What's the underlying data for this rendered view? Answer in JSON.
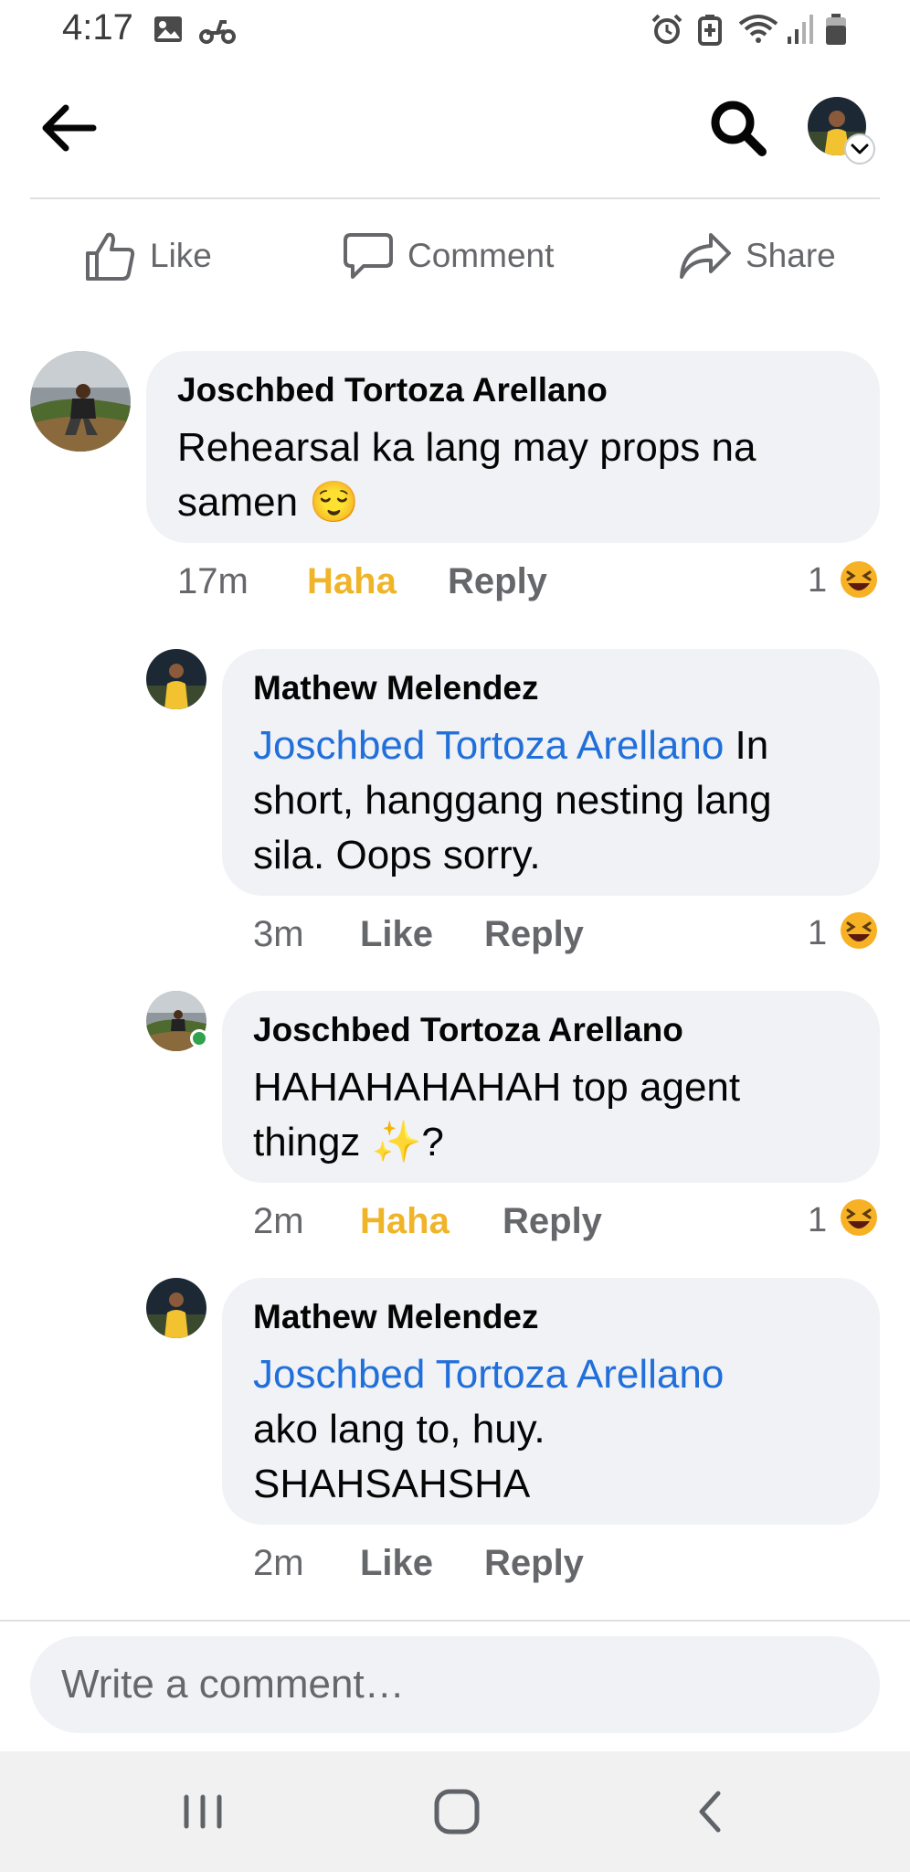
{
  "status_bar": {
    "time": "4:17",
    "left_icons": [
      "image-icon",
      "scooter-icon"
    ],
    "right_icons": [
      "alarm-icon",
      "battery-saver-icon",
      "wifi-icon",
      "signal-icon",
      "battery-icon"
    ]
  },
  "actions": {
    "like_label": "Like",
    "comment_label": "Comment",
    "share_label": "Share"
  },
  "comments": [
    {
      "author": "Joschbed Tortoza Arellano",
      "lines": [
        "Rehearsal ka lang may props na",
        "samen 😌"
      ],
      "time": "17m",
      "reaction_label": "Haha",
      "reaction_active": true,
      "reply_label": "Reply",
      "reaction_count": "1",
      "reaction_emoji": "laughing-emoji"
    },
    {
      "author": "Mathew Melendez",
      "mention": "Joschbed Tortoza Arellano",
      "line1_rest": " In",
      "lines": [
        "short, hanggang nesting lang",
        "sila. Oops sorry."
      ],
      "time": "3m",
      "reaction_label": "Like",
      "reaction_active": false,
      "reply_label": "Reply",
      "reaction_count": "1",
      "reaction_emoji": "laughing-emoji"
    },
    {
      "author": "Joschbed Tortoza Arellano",
      "lines": [
        "HAHAHAHAHAH top agent",
        "thingz ✨?"
      ],
      "time": "2m",
      "reaction_label": "Haha",
      "reaction_active": true,
      "reply_label": "Reply",
      "reaction_count": "1",
      "reaction_emoji": "laughing-emoji",
      "online": true
    },
    {
      "author": "Mathew Melendez",
      "mention": "Joschbed Tortoza Arellano",
      "lines": [
        "ako lang to, huy.",
        "SHAHSAHSHA"
      ],
      "time": "2m",
      "reaction_label": "Like",
      "reaction_active": false,
      "reply_label": "Reply"
    }
  ],
  "composer": {
    "placeholder": "Write a comment…"
  },
  "colors": {
    "mention": "#216fdb",
    "haha_active": "#f0b429",
    "bubble": "#f0f2f5",
    "muted": "#65676b"
  }
}
